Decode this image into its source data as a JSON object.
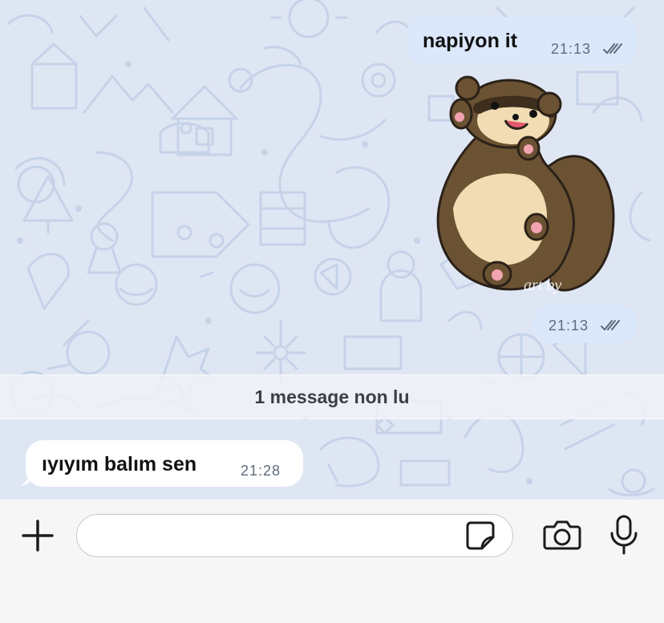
{
  "chat": {
    "messages": [
      {
        "direction": "outgoing",
        "text": "napiyon it",
        "time": "21:13",
        "status": "read-double-check-icon"
      },
      {
        "direction": "outgoing",
        "type": "sticker",
        "sticker_watermark": "art by ",
        "time": "21:13",
        "status": "read-double-check-icon"
      },
      {
        "direction": "incoming",
        "text": "ıyıyım balım sen",
        "time": "21:28"
      }
    ],
    "unread_banner": "1 message non lu"
  },
  "composer": {
    "attach_icon": "plus-icon",
    "input_value": "",
    "sticker_icon": "sticker-icon",
    "camera_icon": "camera-icon",
    "mic_icon": "microphone-icon"
  },
  "colors": {
    "wallpaper": "#dfe6f3",
    "outgoing_bubble": "#dbe8fb",
    "incoming_bubble": "#ffffff",
    "composer_bg": "#f6f6f6"
  }
}
